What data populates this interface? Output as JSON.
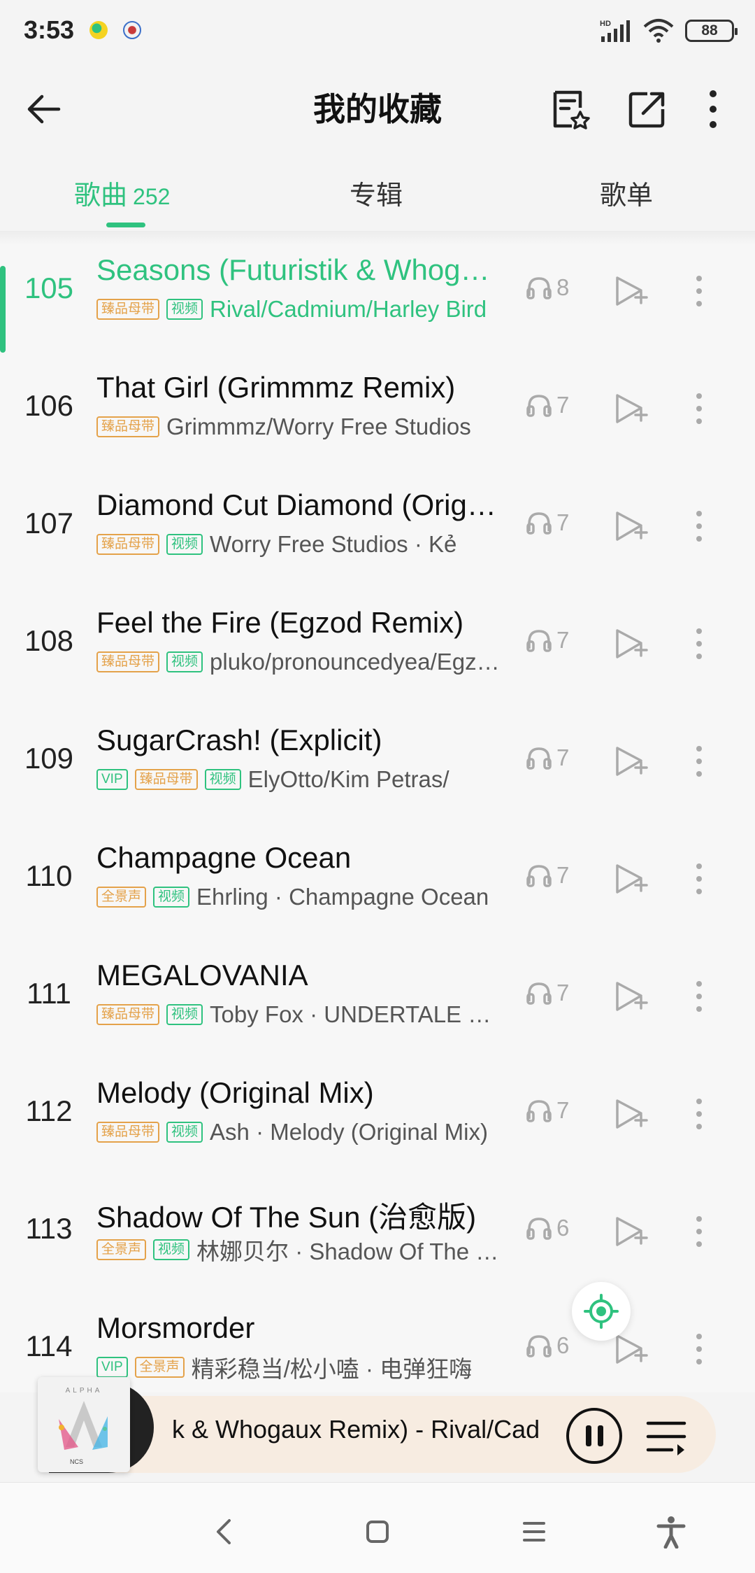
{
  "status_bar": {
    "time": "3:53",
    "battery": "88",
    "hd_label": "HD"
  },
  "header": {
    "title": "我的收藏"
  },
  "tabs": [
    {
      "label": "歌曲",
      "count": "252"
    },
    {
      "label": "专辑"
    },
    {
      "label": "歌单"
    }
  ],
  "songs": [
    {
      "num": "105",
      "title": "Seasons (Futuristik & Whogaux Remix)",
      "badges": [
        "臻品母带",
        "视频"
      ],
      "artist": "Rival/Cadmium/Harley Bird",
      "plays": "8"
    },
    {
      "num": "106",
      "title": "That Girl (Grimmmz Remix)",
      "badges": [
        "臻品母带"
      ],
      "artist": "Grimmmz/Worry Free Studios",
      "plays": "7"
    },
    {
      "num": "107",
      "title": "Diamond Cut Diamond (Original Mix)",
      "badges": [
        "臻品母带",
        "视频"
      ],
      "artist": "Worry Free Studios · Kẻ",
      "plays": "7"
    },
    {
      "num": "108",
      "title": "Feel the Fire (Egzod Remix)",
      "badges": [
        "臻品母带",
        "视频"
      ],
      "artist": "pluko/pronouncedyea/Egzod",
      "plays": "7"
    },
    {
      "num": "109",
      "title": "SugarCrash! (Explicit)",
      "badges": [
        "VIP",
        "臻品母带",
        "视频"
      ],
      "artist": "ElyOtto/Kim Petras/",
      "plays": "7"
    },
    {
      "num": "110",
      "title": "Champagne Ocean",
      "badges": [
        "全景声",
        "视频"
      ],
      "artist": "Ehrling · Champagne Ocean",
      "plays": "7"
    },
    {
      "num": "111",
      "title": "MEGALOVANIA",
      "badges": [
        "臻品母带",
        "视频"
      ],
      "artist": "Toby Fox · UNDERTALE Soundtrack",
      "plays": "7"
    },
    {
      "num": "112",
      "title": "Melody (Original Mix)",
      "badges": [
        "臻品母带",
        "视频"
      ],
      "artist": "Ash · Melody (Original Mix)",
      "plays": "7"
    },
    {
      "num": "113",
      "title": "Shadow Of The Sun (治愈版)",
      "badges": [
        "全景声",
        "视频"
      ],
      "artist": "林娜贝尔 · Shadow Of The Sun",
      "plays": "6"
    },
    {
      "num": "114",
      "title": "Morsmorder",
      "badges": [
        "VIP",
        "全景声"
      ],
      "artist": "精彩稳当/松小嗑 · 电弹狂嗨",
      "plays": "6"
    }
  ],
  "player": {
    "now_playing": "k & Whogaux Remix) - Rival/Cad",
    "cover_top": "ALPHA",
    "cover_bottom": "NCS"
  },
  "colors": {
    "accent": "#2fc27f",
    "gold": "#e4a24a"
  }
}
